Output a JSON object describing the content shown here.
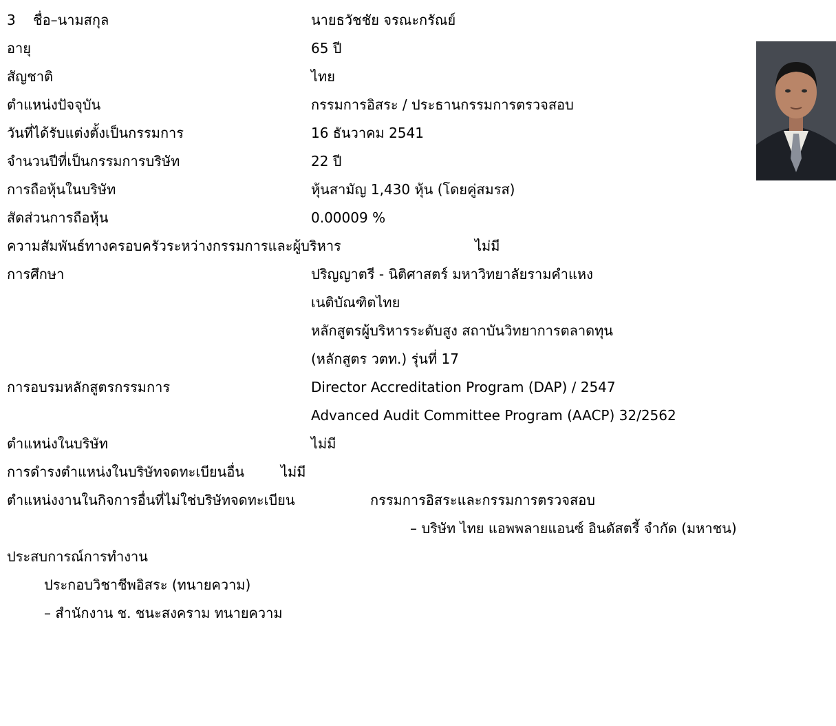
{
  "profile": {
    "number": "3",
    "name_label": "ชื่อ–นามสกุล",
    "name_value": "นายธวัชชัย จรณะกรัณย์",
    "age_label": "อายุ",
    "age_value": "65 ปี",
    "nationality_label": "สัญชาติ",
    "nationality_value": "ไทย",
    "position_label": "ตำแหน่งปัจจุบัน",
    "position_value": "กรรมการอิสระ / ประธานกรรมการตรวจสอบ",
    "appointed_label": "วันที่ได้รับแต่งตั้งเป็นกรรมการ",
    "appointed_value": "16 ธันวาคม 2541",
    "years_label": "จำนวนปีที่เป็นกรรมการบริษัท",
    "years_value": "22 ปี",
    "shares_label": "การถือหุ้นในบริษัท",
    "shares_value": "หุ้นสามัญ 1,430 หุ้น (โดยคู่สมรส)",
    "ratio_label": "สัดส่วนการถือหุ้น",
    "ratio_value": "0.00009 %",
    "family_label": "ความสัมพันธ์ทางครอบครัวระหว่างกรรมการและผู้บริหาร",
    "family_value": "ไม่มี",
    "education_label": "การศึกษา",
    "education": [
      "ปริญญาตรี - นิติศาสตร์ มหาวิทยาลัยรามคำแหง",
      "เนติบัณฑิตไทย",
      "หลักสูตรผู้บริหารระดับสูง สถาบันวิทยาการตลาดทุน",
      "(หลักสูตร วตท.) รุ่นที่ 17"
    ],
    "training_label": "การอบรมหลักสูตรกรรมการ",
    "training": [
      "Director Accreditation Program (DAP) / 2547",
      "Advanced Audit Committee Program (AACP) 32/2562"
    ],
    "company_position_label": "ตำแหน่งในบริษัท",
    "company_position_value": "ไม่มี",
    "listed_label": "การดำรงตำแหน่งในบริษัทจดทะเบียนอื่น",
    "listed_value": "ไม่มี",
    "nonlisted_label": "ตำแหน่งงานในกิจการอื่นที่ไม่ใช่บริษัทจดทะเบียน",
    "nonlisted_value": "กรรมการอิสระและกรรมการตรวจสอบ",
    "nonlisted_company": "– บริษัท ไทย แอพพลายแอนซ์ อินดัสตรี้ จำกัด (มหาชน)",
    "experience_label": "ประสบการณ์การทำงาน",
    "experience_line1": "ประกอบวิชาชีพอิสระ (ทนายความ)",
    "experience_line2": "– สำนักงาน ช. ชนะสงคราม ทนายความ"
  },
  "photo": {
    "bg": "#3c3f45",
    "suit": "#1d2026",
    "shirt": "#e9e7e1",
    "tie": "#8a8f99",
    "skin": "#b98568"
  }
}
